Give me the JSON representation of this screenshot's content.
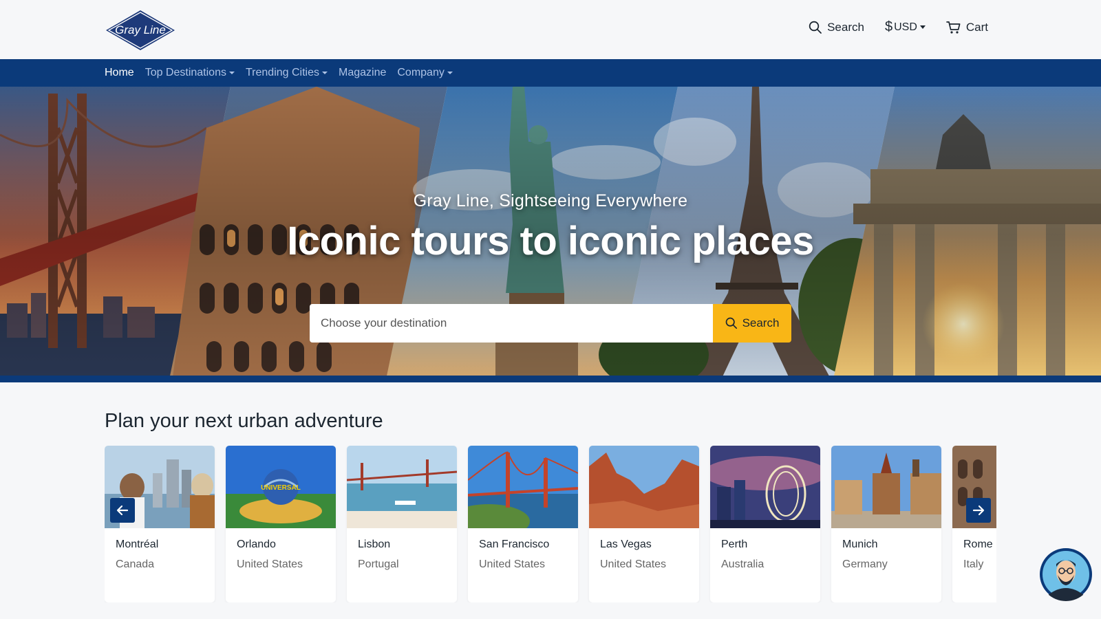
{
  "brand": {
    "logo_text": "Gray Line"
  },
  "header": {
    "search_label": "Search",
    "currency_symbol": "$",
    "currency_label": "USD",
    "cart_label": "Cart"
  },
  "nav": {
    "items": [
      {
        "label": "Home",
        "active": true,
        "dropdown": false
      },
      {
        "label": "Top Destinations",
        "active": false,
        "dropdown": true
      },
      {
        "label": "Trending Cities",
        "active": false,
        "dropdown": true
      },
      {
        "label": "Magazine",
        "active": false,
        "dropdown": false
      },
      {
        "label": "Company",
        "active": false,
        "dropdown": true
      }
    ]
  },
  "hero": {
    "subtitle": "Gray Line, Sightseeing Everywhere",
    "title": "Iconic tours to iconic places",
    "search_placeholder": "Choose your destination",
    "search_button": "Search"
  },
  "section": {
    "title": "Plan your next urban adventure",
    "cards": [
      {
        "city": "Montréal",
        "country": "Canada"
      },
      {
        "city": "Orlando",
        "country": "United States"
      },
      {
        "city": "Lisbon",
        "country": "Portugal"
      },
      {
        "city": "San Francisco",
        "country": "United States"
      },
      {
        "city": "Las Vegas",
        "country": "United States"
      },
      {
        "city": "Perth",
        "country": "Australia"
      },
      {
        "city": "Munich",
        "country": "Germany"
      },
      {
        "city": "Rome",
        "country": "Italy"
      }
    ]
  },
  "colors": {
    "nav_bg": "#0b3a7a",
    "accent": "#f9b616",
    "nav_text": "#aec3e6",
    "page_bg": "#f6f7f9"
  },
  "icons": {
    "search": "magnifier-icon",
    "cart": "cart-icon",
    "prev": "arrow-left-icon",
    "next": "arrow-right-icon",
    "chat": "support-avatar-icon"
  }
}
